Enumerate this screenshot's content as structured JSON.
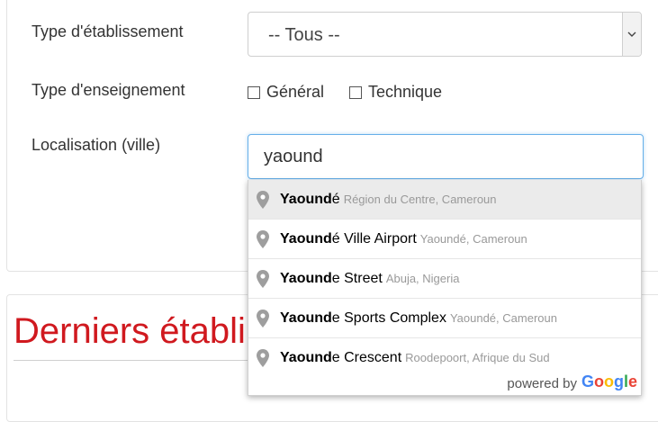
{
  "form": {
    "type_label": "Type d'établissement",
    "type_value": "-- Tous --",
    "enseignement_label": "Type d'enseignement",
    "checkbox_general": "Général",
    "checkbox_technique": "Technique",
    "location_label": "Localisation (ville)",
    "location_value": "yaound"
  },
  "autocomplete": {
    "items": [
      {
        "match": "Yaound",
        "rest": "é",
        "secondary": "Région du Centre, Cameroun"
      },
      {
        "match": "Yaound",
        "rest": "é Ville Airport",
        "secondary": "Yaoundé, Cameroun"
      },
      {
        "match": "Yaound",
        "rest": "e Street",
        "secondary": "Abuja, Nigeria"
      },
      {
        "match": "Yaound",
        "rest": "e Sports Complex",
        "secondary": "Yaoundé, Cameroun"
      },
      {
        "match": "Yaound",
        "rest": "e Crescent",
        "secondary": "Roodepoort, Afrique du Sud"
      }
    ],
    "powered_by": "powered by",
    "google_letters": [
      "G",
      "o",
      "o",
      "g",
      "l",
      "e"
    ],
    "google_colors": [
      "#4285F4",
      "#EA4335",
      "#FBBC05",
      "#4285F4",
      "#34A853",
      "#EA4335"
    ]
  },
  "section": {
    "heading": "Derniers établi"
  },
  "colors": {
    "heading": "#d0191f",
    "focus_border": "#66afe9",
    "pin": "#9e9e9e"
  }
}
